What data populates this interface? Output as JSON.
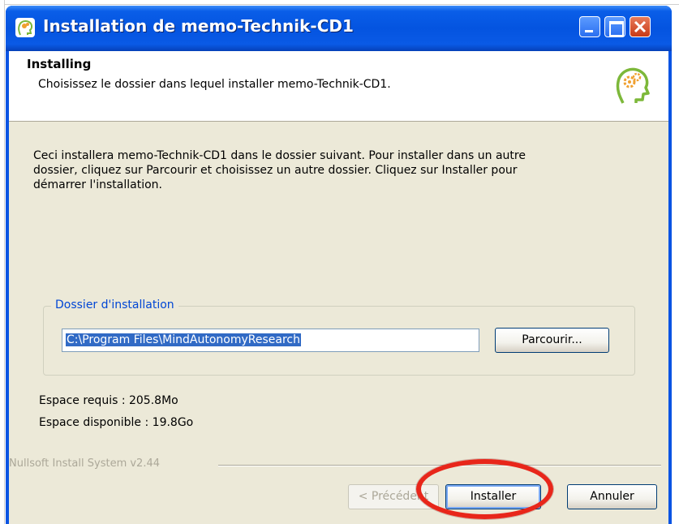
{
  "window": {
    "title": "Installation de memo-Technik-CD1"
  },
  "header": {
    "title": "Installing",
    "subtitle": "Choisissez le dossier dans lequel installer memo-Technik-CD1."
  },
  "content": {
    "description_lines": [
      "Ceci installera memo-Technik-CD1 dans le dossier suivant. Pour installer dans un autre",
      "dossier, cliquez sur Parcourir et choisissez un autre dossier. Cliquez sur Installer pour",
      "démarrer l'installation."
    ],
    "group_label": "Dossier d'installation",
    "install_path": "C:\\Program Files\\MindAutonomyResearch",
    "browse_label": "Parcourir...",
    "space_required": "Espace requis : 205.8Mo",
    "space_available": "Espace disponible : 19.8Go"
  },
  "footer": {
    "branding": "Nullsoft Install System v2.44",
    "back_label": "< Précédent",
    "install_label": "Installer",
    "cancel_label": "Annuler"
  },
  "colors": {
    "title_bar": "#0a54e3",
    "dialog_background": "#ece9d8",
    "group_label": "#0046d5",
    "selection": "#316ac5",
    "highlight_ring": "#e8261a"
  },
  "icons": {
    "app": "head-gears-icon",
    "logo": "head-gears-icon"
  }
}
